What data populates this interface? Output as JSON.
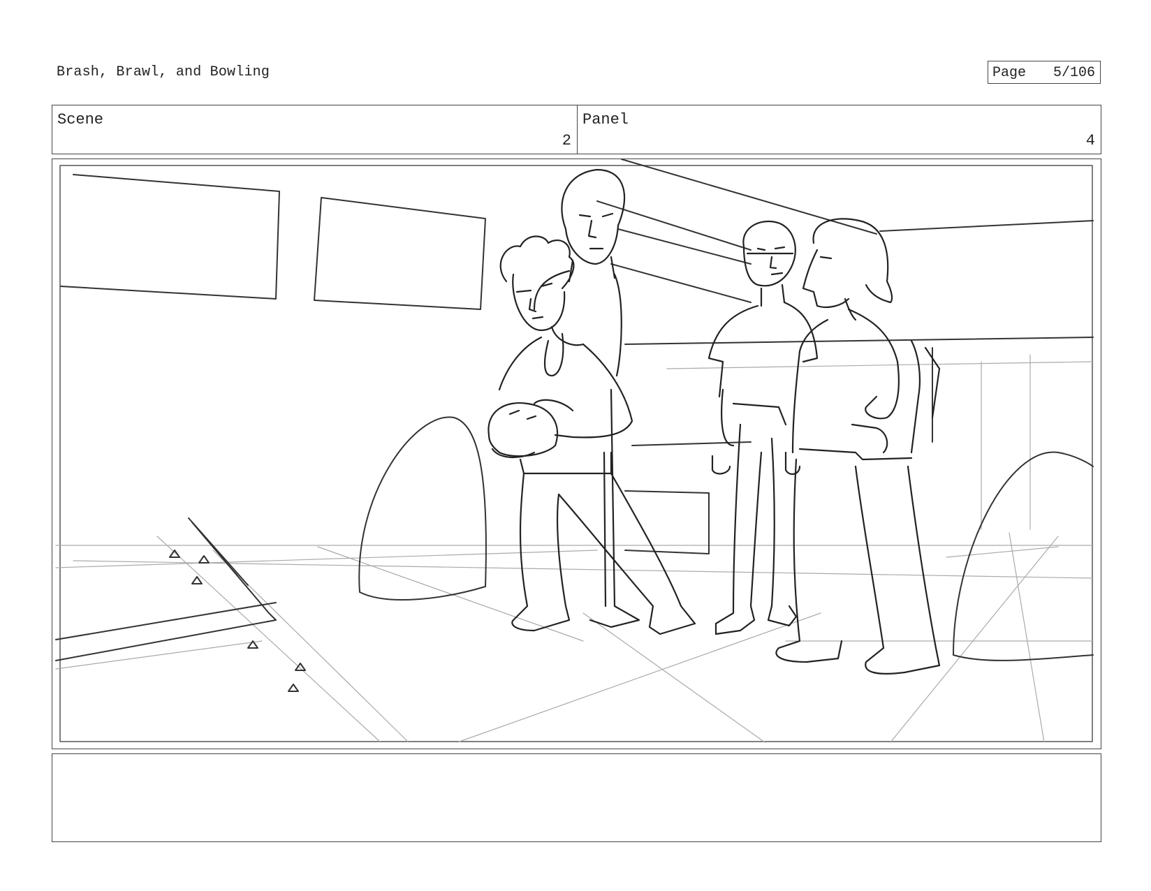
{
  "document": {
    "title": "Brash, Brawl, and Bowling",
    "page_label": "Page",
    "page_number": "5/106"
  },
  "header": {
    "scene_label": "Scene",
    "scene_value": "2",
    "panel_label": "Panel",
    "panel_value": "4"
  },
  "panel": {
    "drawing": "storyboard-sketch-bowling-alley-four-characters",
    "notes": ""
  }
}
